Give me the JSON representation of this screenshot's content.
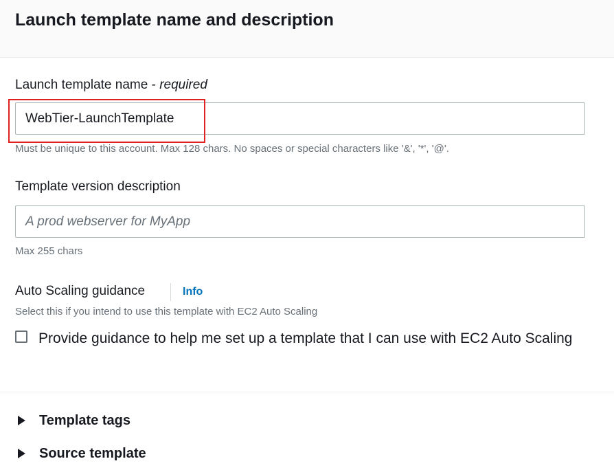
{
  "section": {
    "title": "Launch template name and description"
  },
  "name_field": {
    "label": "Launch template name - ",
    "label_suffix": "required",
    "value": "WebTier-LaunchTemplate",
    "hint": "Must be unique to this account. Max 128 chars. No spaces or special characters like '&', '*', '@'."
  },
  "description_field": {
    "label": "Template version description",
    "placeholder": "A prod webserver for MyApp",
    "hint": "Max 255 chars"
  },
  "auto_scaling": {
    "label": "Auto Scaling guidance",
    "info_link": "Info",
    "description": "Select this if you intend to use this template with EC2 Auto Scaling",
    "checkbox_label": "Provide guidance to help me set up a template that I can use with EC2 Auto Scaling",
    "checked": false
  },
  "expanders": [
    {
      "label": "Template tags"
    },
    {
      "label": "Source template"
    }
  ],
  "colors": {
    "highlight": "#e01f1f",
    "link": "#0073bb"
  }
}
